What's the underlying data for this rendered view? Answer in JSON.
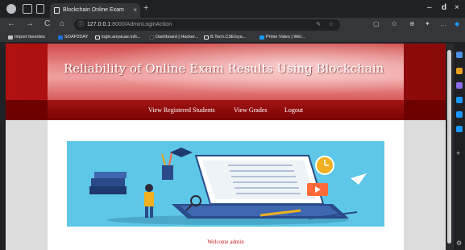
{
  "browser": {
    "tab_title": "Blockchain Online Exam Results",
    "tab_close": "×",
    "new_tab": "+",
    "window_controls": {
      "minimize": "–",
      "maximize": "d",
      "close": "×"
    },
    "nav": {
      "back": "←",
      "forward": "→",
      "reload": "C",
      "home": "⌂"
    },
    "url_host": "127.0.0.1",
    "url_path": ":8000/AdminLoginAction",
    "info_icon": "ⓘ",
    "bookmarks": [
      {
        "label": "Import favorites",
        "color": "#bdc1c6"
      },
      {
        "label": "SOAP2DAY",
        "color": "#1a73e8"
      },
      {
        "label": "login.anyacae.in/li...",
        "color": "#e8eaed"
      },
      {
        "label": "Dashboard | Hacker...",
        "color": "#2d2d2d"
      },
      {
        "label": "B.Tech.CSE/sya...",
        "color": "#e8eaed"
      },
      {
        "label": "Prime Video | Wel...",
        "color": "#1a98ff"
      }
    ]
  },
  "site": {
    "title": "Reliability of Online Exam Results Using Blockchain",
    "nav_links": [
      "View Registered Students",
      "View Grades",
      "Logout"
    ],
    "welcome_text": "Welcome admin"
  },
  "colors": {
    "header_red": "#b01111",
    "nav_dark_red": "#7a0202",
    "banner_blue": "#5ec6e6",
    "welcome_red": "#c81818"
  }
}
